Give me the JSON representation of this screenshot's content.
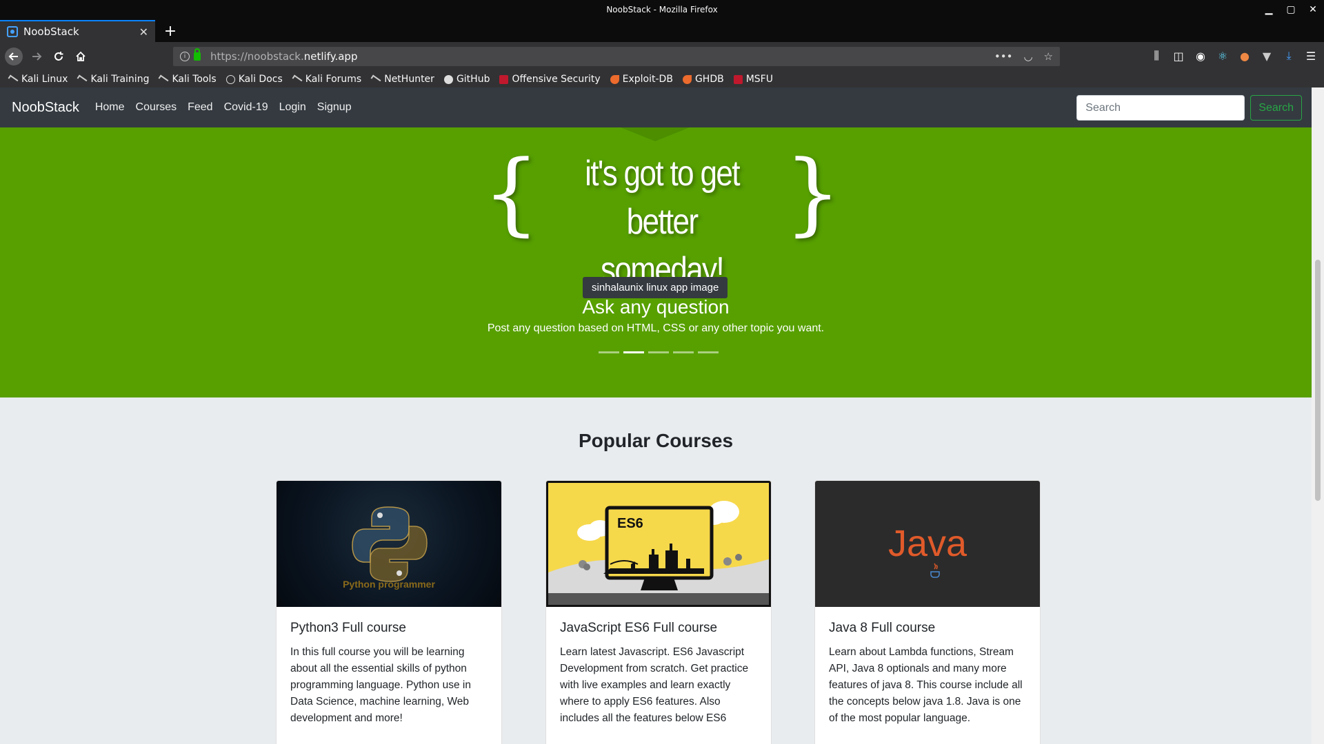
{
  "window": {
    "title": "NoobStack - Mozilla Firefox"
  },
  "tab": {
    "label": "NoobStack"
  },
  "urlbar": {
    "url_prefix": "https://noobstack.",
    "url_domain": "netlify.app"
  },
  "bookmarks": [
    {
      "label": "Kali Linux",
      "icon": "kali-icon"
    },
    {
      "label": "Kali Training",
      "icon": "kali-icon"
    },
    {
      "label": "Kali Tools",
      "icon": "kali-icon"
    },
    {
      "label": "Kali Docs",
      "icon": "globe-icon"
    },
    {
      "label": "Kali Forums",
      "icon": "kali-icon"
    },
    {
      "label": "NetHunter",
      "icon": "kali-icon"
    },
    {
      "label": "GitHub",
      "icon": "github-icon"
    },
    {
      "label": "Offensive Security",
      "icon": "offsec-icon"
    },
    {
      "label": "Exploit-DB",
      "icon": "exploitdb-icon"
    },
    {
      "label": "GHDB",
      "icon": "exploitdb-icon"
    },
    {
      "label": "MSFU",
      "icon": "offsec-icon"
    }
  ],
  "site_nav": {
    "brand": "NoobStack",
    "links": [
      "Home",
      "Courses",
      "Feed",
      "Covid-19",
      "Login",
      "Signup"
    ],
    "search_placeholder": "Search",
    "search_button": "Search"
  },
  "hero": {
    "quote_line1": "it's got to get better",
    "quote_line2": "someday!",
    "tooltip": "sinhalaunix linux app image",
    "caption_title": "Ask any question",
    "caption_text": "Post any question based on HTML, CSS or any other topic you want.",
    "indicator_count": 5,
    "active_indicator": 2,
    "background_color": "#57a000"
  },
  "courses": {
    "section_title": "Popular Courses",
    "items": [
      {
        "title": "Python3 Full course",
        "text": "In this full course you will be learning about all the essential skills of python programming language. Python use in Data Science, machine learning, Web development and more!",
        "image_caption": "Python programmer"
      },
      {
        "title": "JavaScript ES6 Full course",
        "text": "Learn latest Javascript. ES6 Javascript Development from scratch. Get practice with live examples and learn exactly where to apply ES6 features. Also includes all the features below ES6",
        "image_caption": "ES6"
      },
      {
        "title": "Java 8 Full course",
        "text": "Learn about Lambda functions, Stream API, Java 8 optionals and many more features of java 8. This course include all the concepts below java 1.8. Java is one of the most popular language.",
        "image_caption": "Java"
      }
    ]
  }
}
